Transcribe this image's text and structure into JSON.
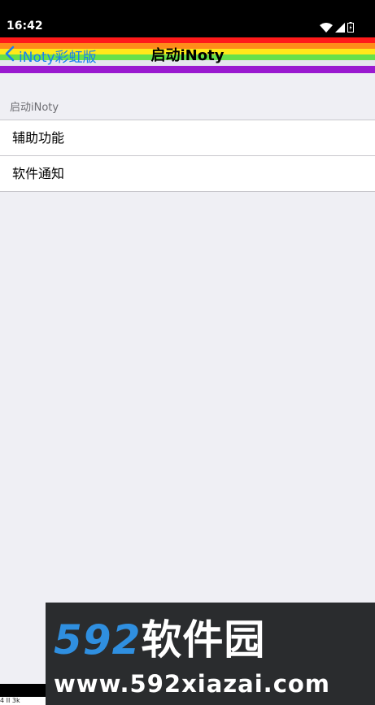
{
  "status_bar": {
    "time": "16:42",
    "icons": [
      "wifi-icon",
      "cellular-signal-icon",
      "battery-icon"
    ]
  },
  "nav": {
    "back_label": "iNoty彩虹版",
    "title": "启动iNoty",
    "accent_color": "#1a7ff0"
  },
  "section": {
    "header": "启动iNoty",
    "items": [
      {
        "label": "辅助功能"
      },
      {
        "label": "软件通知"
      }
    ]
  },
  "watermark": {
    "logo_numbers": "592",
    "logo_text": "软件园",
    "url": "www.592xiazai.com"
  },
  "footer": {
    "text": "4 II 3k"
  }
}
